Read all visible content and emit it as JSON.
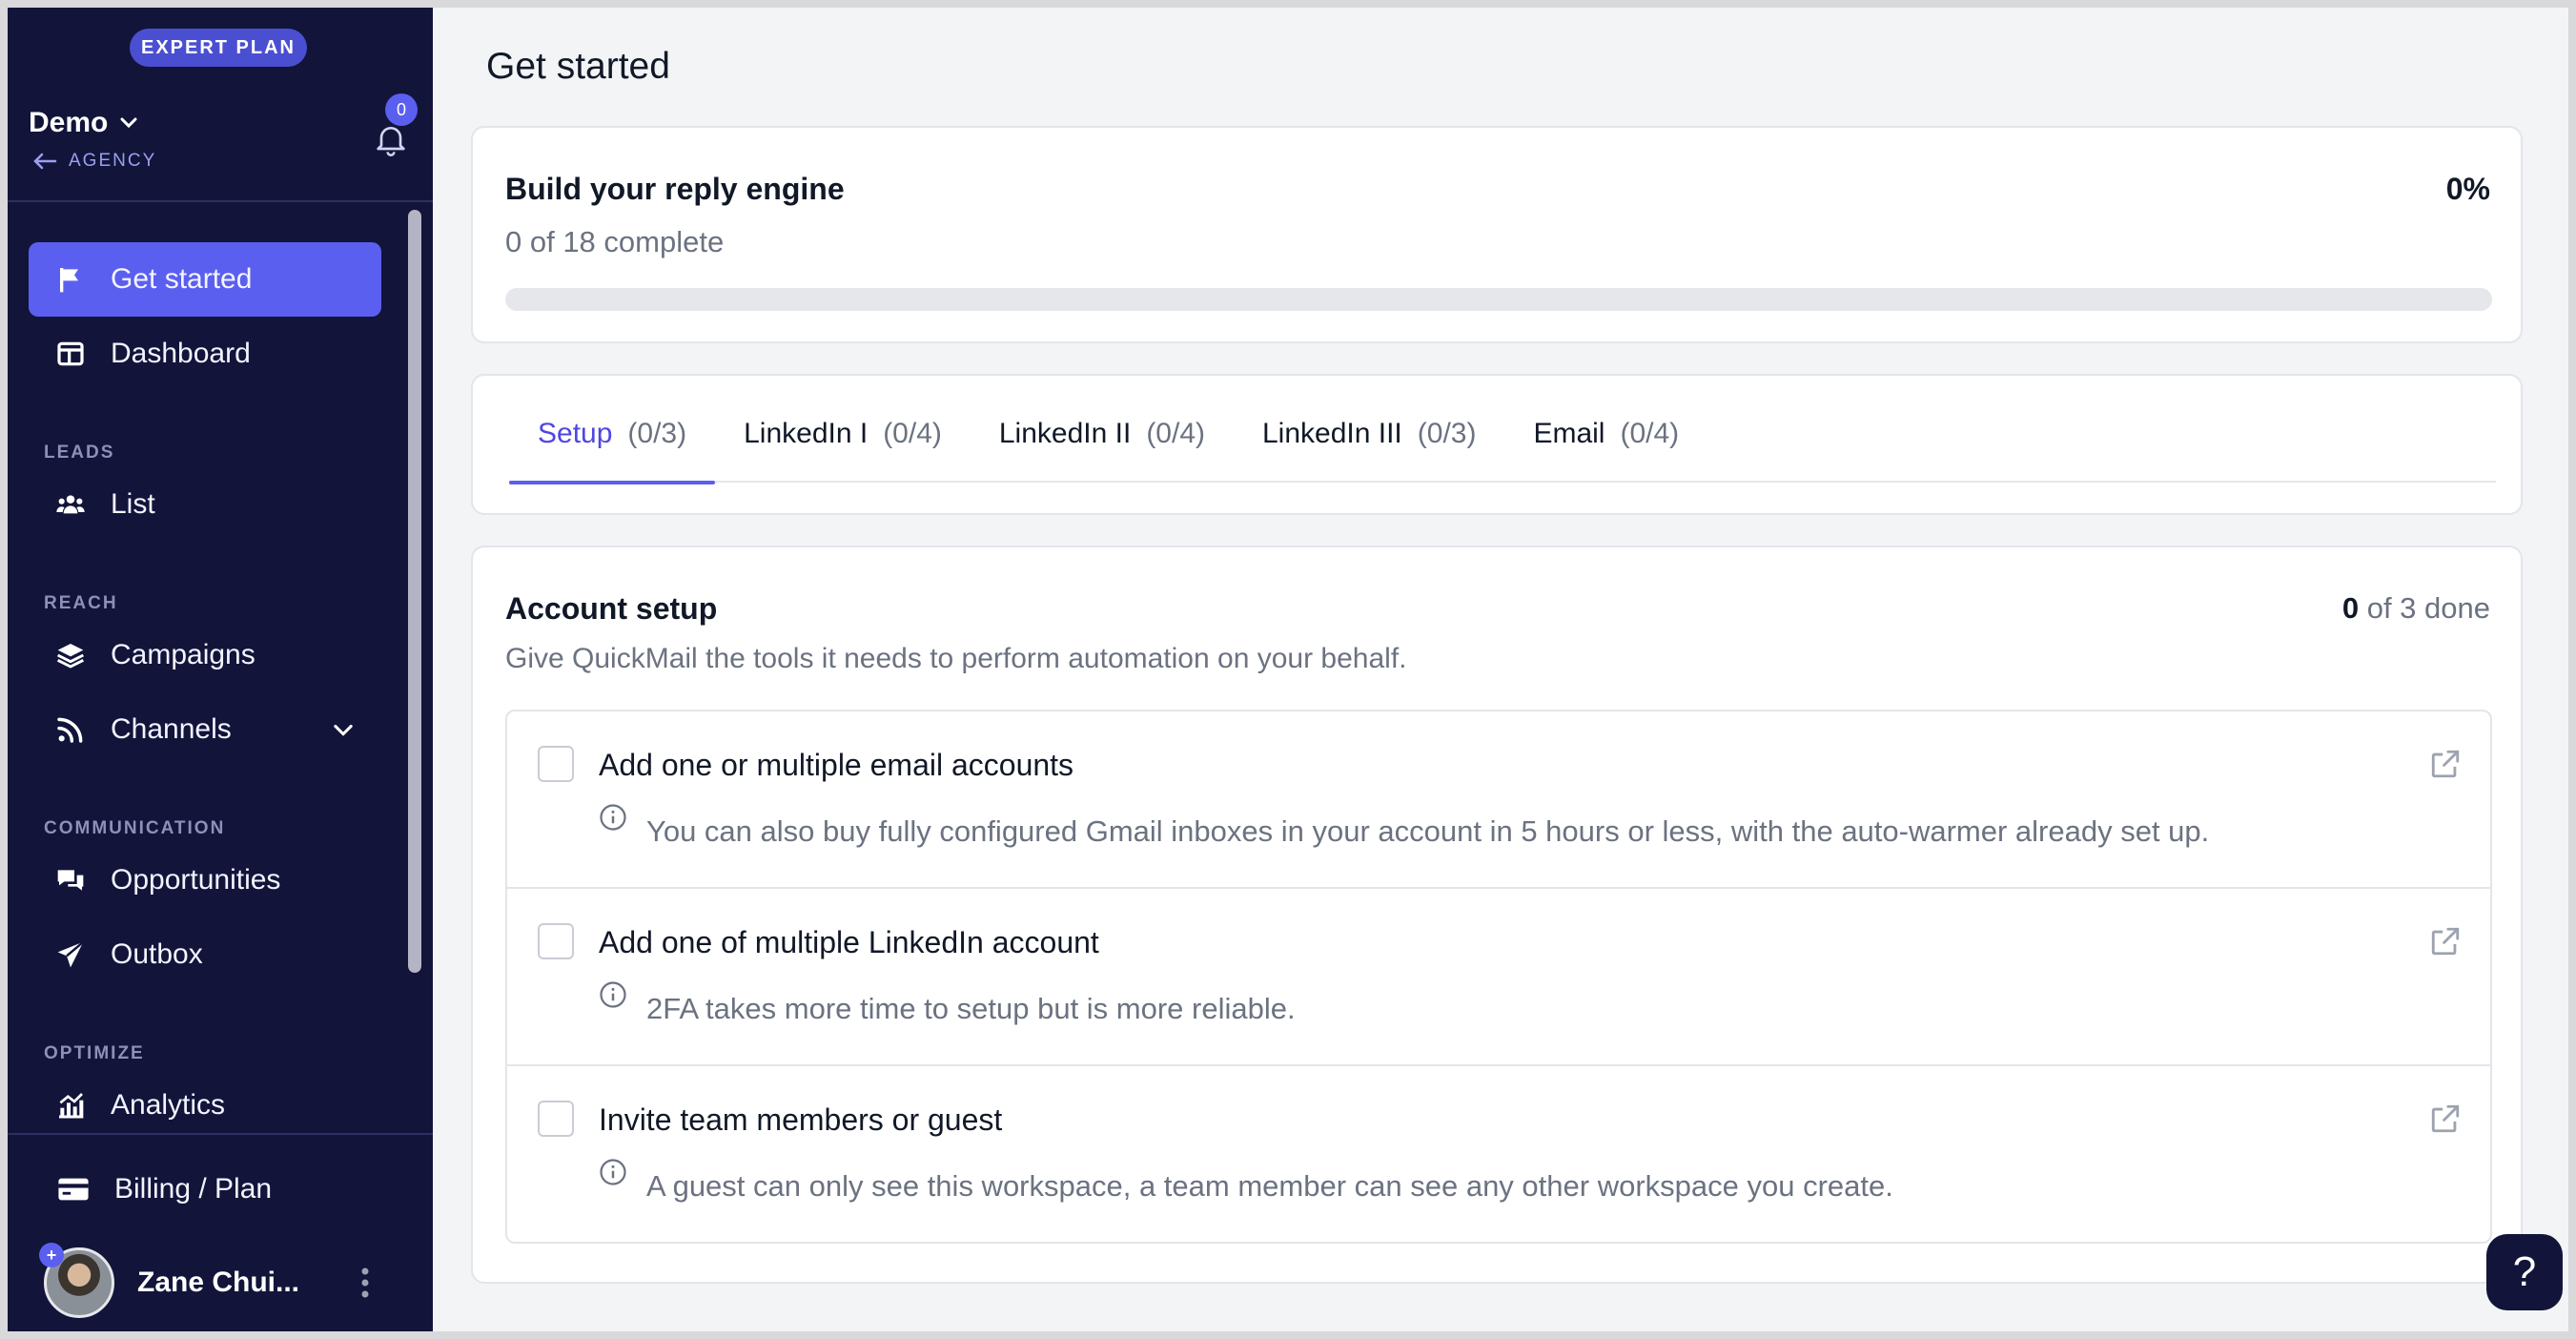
{
  "sidebar": {
    "plan_badge": "EXPERT PLAN",
    "workspace_name": "Demo",
    "back_label": "AGENCY",
    "notifications_count": "0",
    "items": [
      {
        "label": "Get started",
        "icon": "flag-icon",
        "active": true
      },
      {
        "label": "Dashboard",
        "icon": "dashboard-icon"
      },
      {
        "label": "List",
        "icon": "users-icon"
      },
      {
        "label": "Campaigns",
        "icon": "layers-icon"
      },
      {
        "label": "Channels",
        "icon": "rss-icon"
      },
      {
        "label": "Opportunities",
        "icon": "chat-icon"
      },
      {
        "label": "Outbox",
        "icon": "send-icon"
      },
      {
        "label": "Analytics",
        "icon": "analytics-icon"
      }
    ],
    "sections": [
      "LEADS",
      "REACH",
      "COMMUNICATION",
      "OPTIMIZE"
    ],
    "billing_label": "Billing / Plan",
    "user_name": "Zane Chui..."
  },
  "main": {
    "page_title": "Get started",
    "progress": {
      "title": "Build your reply engine",
      "subtitle": "0 of 18 complete",
      "percent_label": "0%",
      "percent": 0
    },
    "tabs": [
      {
        "label": "Setup",
        "count": "(0/3)",
        "active": true
      },
      {
        "label": "LinkedIn I",
        "count": "(0/4)"
      },
      {
        "label": "LinkedIn II",
        "count": "(0/4)"
      },
      {
        "label": "LinkedIn III",
        "count": "(0/3)"
      },
      {
        "label": "Email",
        "count": "(0/4)"
      }
    ],
    "setup": {
      "title": "Account setup",
      "description": "Give QuickMail the tools it needs to perform automation on your behalf.",
      "done_count": "0",
      "done_suffix": "of 3 done",
      "tasks": [
        {
          "title": "Add one or multiple email accounts",
          "note": "You can also buy fully configured Gmail inboxes in your account in 5 hours or less, with the auto-warmer already set up."
        },
        {
          "title": "Add one of multiple LinkedIn account",
          "note": "2FA takes more time to setup but is more reliable."
        },
        {
          "title": "Invite team members or guest",
          "note": "A guest can only see this workspace, a team member can see any other workspace you create."
        }
      ]
    }
  },
  "help_label": "?",
  "colors": {
    "accent": "#5b5ff0",
    "sidebar_bg": "#12143a",
    "page_bg": "#f3f4f6"
  }
}
